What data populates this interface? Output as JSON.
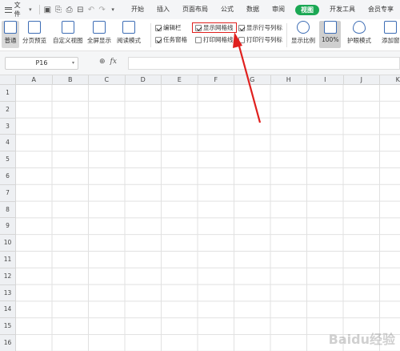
{
  "topbar": {
    "file_label": "文件",
    "tabs": [
      "开始",
      "插入",
      "页面布局",
      "公式",
      "数据",
      "审阅",
      "视图",
      "开发工具",
      "会员专享"
    ],
    "active_tab": "视图"
  },
  "ribbon": {
    "normal": "普通",
    "page_preview": "分页预览",
    "custom_view": "自定义视图",
    "full_screen": "全屏显示",
    "read_mode": "阅读模式",
    "edit_bar": "编辑栏",
    "show_gridlines": "显示网格线",
    "show_row_col": "显示行号列标",
    "task_pane": "任务窗格",
    "print_gridlines": "打印网格线",
    "print_row_col": "打印行号列标",
    "zoom": "显示比例",
    "zoom_100": "100%",
    "eye_mode": "护眼模式",
    "add_window": "添加窗"
  },
  "formula_bar": {
    "cell_ref": "P16",
    "fx": "fx"
  },
  "grid": {
    "columns": [
      "A",
      "B",
      "C",
      "D",
      "E",
      "F",
      "G",
      "H",
      "I",
      "J",
      "K"
    ],
    "rows": [
      "1",
      "2",
      "3",
      "4",
      "5",
      "6",
      "7",
      "8",
      "9",
      "10",
      "11",
      "12",
      "13",
      "14",
      "15",
      "16"
    ]
  },
  "watermark": "Baidu经验",
  "colors": {
    "active_tab": "#1ba854",
    "annotation": "#e0201e"
  }
}
